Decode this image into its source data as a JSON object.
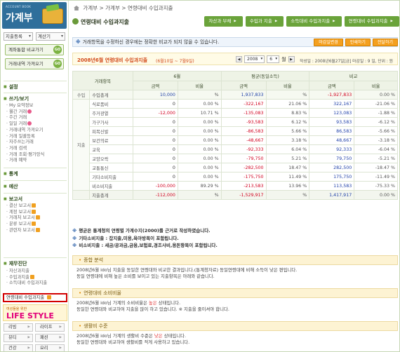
{
  "sidebar": {
    "logo": {
      "small": "ACCOUNT BOOK",
      "big": "가계부"
    },
    "selects": [
      "지출등록",
      "계산기"
    ],
    "green_buttons": [
      {
        "label": "계좌통합 비교가기",
        "go": "GO"
      },
      {
        "label": "거래내역 가져오기",
        "go": "GO"
      }
    ],
    "sections": {
      "settings": "설정",
      "write_view": "쓰기/보기",
      "stats": "통계",
      "budget": "예산",
      "report": "보고서",
      "diagnosis": "재무진단"
    },
    "write_items": [
      "My 요약정보",
      "월간 거래",
      "주간 거래",
      "일일 거래",
      "거래내역 가져오기",
      "거래 일괄등록",
      "자주쓰는거래",
      "거래 검색",
      "거래 조회·평가앙식",
      "거래 예약"
    ],
    "report_items": [
      "결산 보고서",
      "계정 보고서",
      "거래처 보고서",
      "분류 보고서",
      "관련자 보고서"
    ],
    "diagnosis_items": [
      "자산과지출",
      "수입과지출",
      "소득대비 수입과지출"
    ],
    "active_item": "연령대비 수입과지출",
    "lifestyle": {
      "top": "여성들을 위한",
      "title": "LIFE STYLE"
    },
    "lifestyle_buttons": [
      "리빙",
      "라이프",
      "뷰티",
      "패션",
      "건강",
      "요리"
    ]
  },
  "breadcrumb": [
    "가계부",
    "가계부",
    "연령대비 수입과지출"
  ],
  "page_title": "연령대비 수입과지출",
  "tabs": [
    "자산과 부채",
    "수입과 지출",
    "소득대비 수입과지출",
    "연령대비 수입과지출"
  ],
  "notice": {
    "mark": "※",
    "text": "거래항목을 수정하신 경우에는 정확한 비교가 되지 않을 수 있습니다."
  },
  "action_buttons": [
    "마감일변경",
    "인쇄하기",
    "전달하기"
  ],
  "period": {
    "label": "2008년6월 연령대비 수입과지출",
    "range": "(6월10일 ~ 7월9일)",
    "year": "2008",
    "month": "6",
    "month_suffix": "월",
    "meta": "작성일 : 2008년6월27일[금]    마감일 : 9 일, 단위 : 원"
  },
  "table": {
    "headers": {
      "category": "거래항목",
      "june": "6월",
      "avg": "평균(동일소득)",
      "compare": "비교",
      "amount": "금액",
      "ratio": "비율"
    },
    "income_row": {
      "cat": "수입",
      "item": "수입총계",
      "m_amt": "10,000",
      "m_pct": "%",
      "a_amt": "1,937,833",
      "a_pct": "%",
      "c_amt": "-1,927,833",
      "c_pct": "0.00 %"
    },
    "expense_label": "지출",
    "rows": [
      {
        "item": "식료품비",
        "m_amt": "0",
        "m_pct": "0.00 %",
        "a_amt": "-322,167",
        "a_pct": "21.06 %",
        "c_amt": "322,167",
        "c_pct": "-21.06 %"
      },
      {
        "item": "주거광열",
        "m_amt": "-12,000",
        "m_pct": "10.71 %",
        "a_amt": "-135,083",
        "a_pct": "8.83 %",
        "c_amt": "123,083",
        "c_pct": "-1.88 %"
      },
      {
        "item": "가구가사",
        "m_amt": "0",
        "m_pct": "0.00 %",
        "a_amt": "-93,583",
        "a_pct": "6.12 %",
        "c_amt": "93,583",
        "c_pct": "-6.12 %"
      },
      {
        "item": "피복신발",
        "m_amt": "0",
        "m_pct": "0.00 %",
        "a_amt": "-86,583",
        "a_pct": "5.66 %",
        "c_amt": "86,583",
        "c_pct": "-5.66 %"
      },
      {
        "item": "보건의료",
        "m_amt": "0",
        "m_pct": "0.00 %",
        "a_amt": "-48,667",
        "a_pct": "3.18 %",
        "c_amt": "48,667",
        "c_pct": "-3.18 %"
      },
      {
        "item": "교육",
        "m_amt": "0",
        "m_pct": "0.00 %",
        "a_amt": "-92,333",
        "a_pct": "6.04 %",
        "c_amt": "92,333",
        "c_pct": "-6.04 %"
      },
      {
        "item": "교양오락",
        "m_amt": "0",
        "m_pct": "0.00 %",
        "a_amt": "-79,750",
        "a_pct": "5.21 %",
        "c_amt": "79,750",
        "c_pct": "-5.21 %"
      },
      {
        "item": "교통통신",
        "m_amt": "0",
        "m_pct": "0.00 %",
        "a_amt": "-282,500",
        "a_pct": "18.47 %",
        "c_amt": "282,500",
        "c_pct": "-18.47 %"
      },
      {
        "item": "기타소비지출",
        "m_amt": "0",
        "m_pct": "0.00 %",
        "a_amt": "-175,750",
        "a_pct": "11.49 %",
        "c_amt": "175,750",
        "c_pct": "-11.49 %"
      },
      {
        "item": "비소비지출",
        "m_amt": "-100,000",
        "m_pct": "89.29 %",
        "a_amt": "-213,583",
        "a_pct": "13.96 %",
        "c_amt": "113,583",
        "c_pct": "-75.33 %"
      },
      {
        "item": "지출총계",
        "m_amt": "-112,000",
        "m_pct": "%",
        "a_amt": "-1,529,917",
        "a_pct": "%",
        "c_amt": "1,417,917",
        "c_pct": "0.00 %"
      }
    ]
  },
  "notes": [
    {
      "mark": "※",
      "text": "평균은 통계청의 연령별 가계수지(2000)를 근거로 작성하였습니다."
    },
    {
      "mark": "※",
      "text": "기타소비지출 : 잡지출,미용,욕아방목이 포함됩니다."
    },
    {
      "mark": "※",
      "text": "비소비지출 : 세금/공과금,금융,보험료,경조사비,용돈항목이 포함됩니다."
    }
  ],
  "panels": {
    "overall": {
      "title": "종합 분석",
      "lines": [
        "2008년6월 ido님 지출을 동일한 연령대와 비교한 결과입니다.(통계청자료) 동일연령대에 비해 소득이 낮은 편입니다.",
        "동일 연령대에 비해 높은 소비를 보이고 있는 지출항목은 아래와 같습니다."
      ]
    },
    "consumption": {
      "title": "연령대비 소비비율",
      "line1_pre": "2008년6월 ido님 가계의 소비비율은 ",
      "line1_hl": "높은",
      "line1_post": " 상태입니다.",
      "line2": "동일한 연령대와 비교하여 지출을 많이 하고 있습니다. ※ 지출을 줄이셔야 합니다."
    },
    "living": {
      "title": "생활비 수준",
      "line1_pre": "2008년6월 ido님 가계의 생활비 수준은 ",
      "line1_hl": "낮은",
      "line1_post": " 상태입니다.",
      "line2": "동일한 연령대와 비교하여 생활비를 적게 사용하고 있습니다."
    }
  }
}
